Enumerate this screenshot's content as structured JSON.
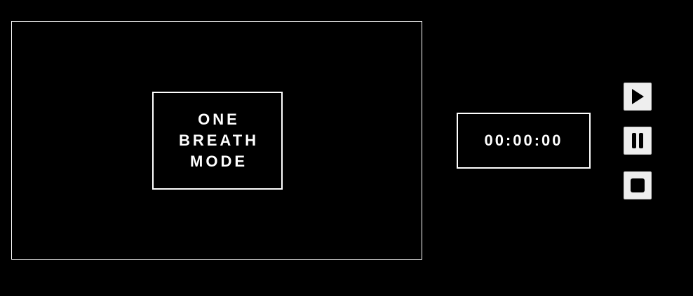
{
  "mode": {
    "lines": [
      "ONE",
      "BREATH",
      "MODE"
    ]
  },
  "timer": {
    "value": "00:00:00"
  },
  "controls": {
    "play_icon": "play-icon",
    "pause_icon": "pause-icon",
    "stop_icon": "stop-icon"
  },
  "colors": {
    "background": "#000000",
    "foreground": "#ffffff",
    "button_bg": "#eeeeee",
    "icon": "#000000"
  }
}
